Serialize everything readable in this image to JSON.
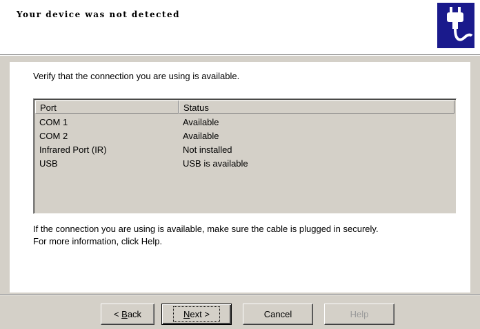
{
  "header": {
    "title": "Your device was not detected",
    "icon": "device-connection-icon"
  },
  "intro": "Verify that the connection you are using is available.",
  "port_list": {
    "columns": [
      "Port",
      "Status"
    ],
    "rows": [
      {
        "port": "COM 1",
        "status": "Available"
      },
      {
        "port": "COM 2",
        "status": "Available"
      },
      {
        "port": "Infrared Port (IR)",
        "status": "Not installed"
      },
      {
        "port": "USB",
        "status": "USB is available"
      }
    ]
  },
  "footer": {
    "line1": "If the connection you are using is available, make sure the cable is plugged in securely.",
    "line2": "For more information, click Help."
  },
  "buttons": {
    "back_prefix": "< ",
    "back_mnemonic": "B",
    "back_rest": "ack",
    "next_mnemonic": "N",
    "next_rest": "ext >",
    "cancel": "Cancel",
    "help": "Help"
  },
  "colors": {
    "dialog_bg": "#d4d0c8",
    "icon_bg": "#1a1a8c"
  }
}
